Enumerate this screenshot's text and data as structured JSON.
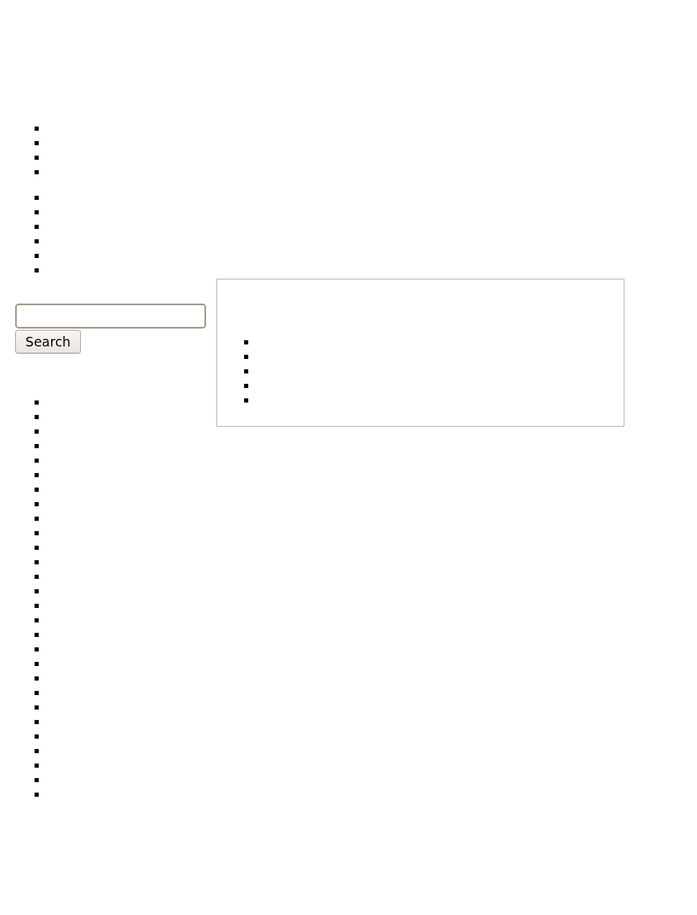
{
  "top_lists": [
    {
      "items": [
        {
          "kind": "bullet"
        },
        {
          "kind": "bullet"
        },
        {
          "kind": "bullet"
        },
        {
          "kind": "bullet"
        }
      ]
    },
    {
      "items": [
        {
          "kind": "bullet"
        },
        {
          "kind": "bullet"
        },
        {
          "kind": "bullet"
        },
        {
          "kind": "bullet"
        },
        {
          "kind": "bullet"
        },
        {
          "kind": "bullet"
        }
      ]
    }
  ],
  "search": {
    "button_label": "Search"
  },
  "side_list": {
    "items": [
      {
        "kind": "bullet"
      },
      {
        "kind": "bullet"
      },
      {
        "kind": "bullet"
      },
      {
        "kind": "bullet"
      },
      {
        "kind": "bullet"
      },
      {
        "kind": "bullet"
      },
      {
        "kind": "bullet"
      },
      {
        "kind": "bullet"
      },
      {
        "kind": "bullet"
      },
      {
        "kind": "bullet"
      },
      {
        "kind": "bullet"
      },
      {
        "kind": "bullet"
      },
      {
        "kind": "bullet"
      },
      {
        "kind": "bullet"
      },
      {
        "kind": "bullet"
      },
      {
        "kind": "bullet"
      },
      {
        "kind": "bullet"
      },
      {
        "kind": "bullet"
      },
      {
        "kind": "bullet"
      },
      {
        "kind": "bullet"
      },
      {
        "kind": "bullet"
      },
      {
        "kind": "bullet"
      },
      {
        "kind": "bullet"
      },
      {
        "kind": "bullet"
      },
      {
        "kind": "bullet"
      },
      {
        "kind": "bullet"
      },
      {
        "kind": "bullet"
      },
      {
        "kind": "bullet"
      }
    ]
  },
  "panel": {
    "items": [
      {
        "kind": "bullet"
      },
      {
        "kind": "bullet"
      },
      {
        "kind": "bullet"
      },
      {
        "kind": "bullet"
      },
      {
        "kind": "bullet"
      }
    ]
  }
}
